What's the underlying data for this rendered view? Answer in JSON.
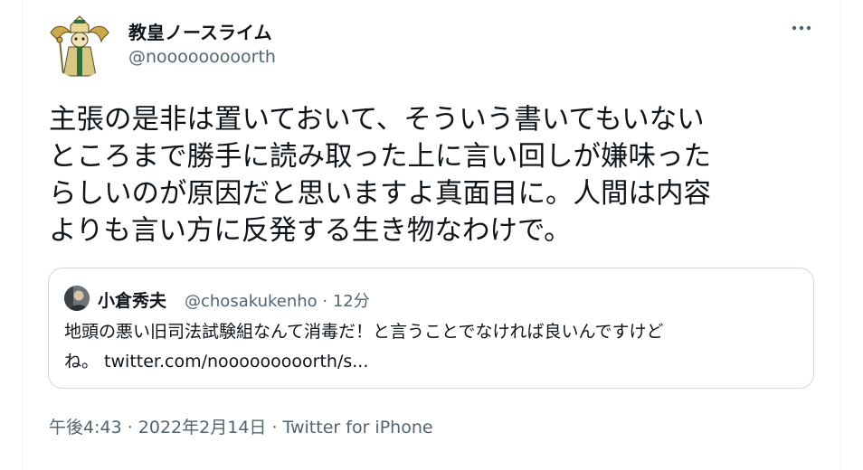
{
  "tweet": {
    "author": {
      "display_name": "教皇ノースライム",
      "handle": "@nooooooooorth",
      "avatar_icon": "pope-slime-avatar-icon"
    },
    "more_icon": "more-horizontal-icon",
    "text_lines": [
      "主張の是非は置いておいて、そういう書いてもいない",
      "ところまで勝手に読み取った上に言い回しが嫌味った",
      "らしいのが原因だと思いますよ真面目に。人間は内容",
      "よりも言い方に反発する生き物なわけで。"
    ],
    "quoted": {
      "display_name": "小倉秀夫",
      "meta": "@chosakukenho · 12分",
      "text_line1": "地頭の悪い旧司法試験組なんて消毒だ！と言うことでなければ良いんですけど",
      "text_line2_prefix": "ね。 ",
      "link": "twitter.com/nooooooooorth/s..."
    },
    "timestamp": "午後4:43 · 2022年2月14日 · ",
    "source": "Twitter for iPhone"
  },
  "colors": {
    "text": "#0f1419",
    "secondary": "#536471",
    "border": "#cfd9de"
  }
}
